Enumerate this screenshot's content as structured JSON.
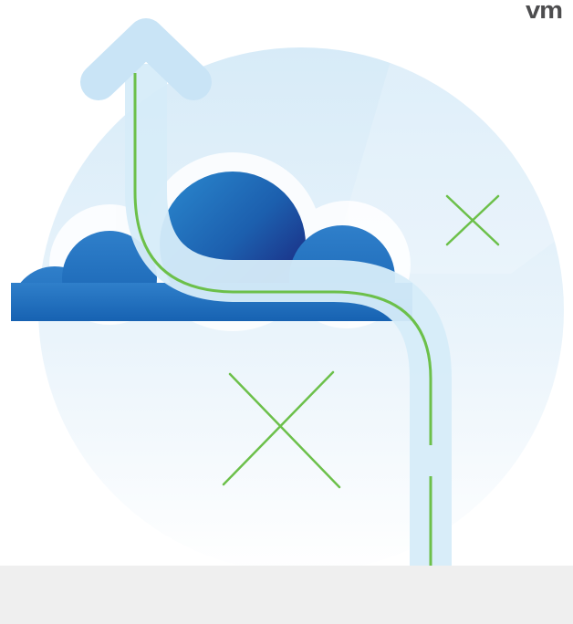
{
  "logo": {
    "text": "vm",
    "color": "#4d4d4f"
  },
  "colors": {
    "footer": "#efefef",
    "circle_top": "#d7ebf8",
    "circle_bottom": "#ffffff",
    "cloud_dark": "#1b3a8f",
    "cloud_mid": "#1c5fae",
    "cloud_light": "#2b8ad0",
    "path_fill": "#d6ecf9",
    "accent_green": "#6cc04a"
  },
  "icons": [
    "up-arrow-icon",
    "cross-mark-icon",
    "cloud-icon"
  ]
}
